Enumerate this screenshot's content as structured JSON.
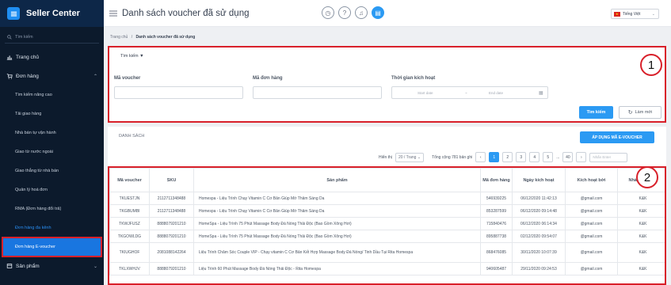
{
  "sidebar": {
    "brand": "Seller Center",
    "search_placeholder": "Tìm kiếm",
    "items": [
      {
        "label": "Trang chủ"
      },
      {
        "label": "Đơn hàng"
      }
    ],
    "sub_items": [
      {
        "label": "Tìm kiếm nâng cao"
      },
      {
        "label": "Tải giao hàng"
      },
      {
        "label": "Nhà bán tự vận hành"
      },
      {
        "label": "Giao từ nước ngoài"
      },
      {
        "label": "Giao thẳng từ nhà bán"
      },
      {
        "label": "Quản lý hoá đơn"
      },
      {
        "label": "RMA (Đơn hàng đổi trả)"
      },
      {
        "label": "Đơn hàng đa kênh"
      },
      {
        "label": "Đơn hàng E-voucher"
      }
    ],
    "bottom_item": "Sản phẩm"
  },
  "header": {
    "title": "Danh sách voucher đã sử dụng",
    "language": "Tiếng Việt"
  },
  "breadcrumb": {
    "home": "Trang chủ",
    "separator": "/",
    "current": "Danh sách voucher đã sử dụng"
  },
  "search_panel": {
    "toggle_label": "Tìm kiếm ▼",
    "voucher_label": "Mã voucher",
    "order_label": "Mã đơn hàng",
    "time_label": "Thời gian kích hoạt",
    "start_placeholder": "Start date",
    "arrow": "~",
    "end_placeholder": "End date",
    "search_button": "Tìm kiếm",
    "reset_button": "Làm mới",
    "badge": "1"
  },
  "list_panel": {
    "title": "DANH SÁCH",
    "apply_button": "ÁP DỤNG MÃ E-VOUCHER",
    "show_label": "Hiển thị",
    "per_page": "20 / Trang",
    "total": "Tổng cộng 781 bản ghi",
    "pages": [
      "1",
      "2",
      "3",
      "4",
      "5",
      "...",
      "40"
    ],
    "goto_placeholder": "Nhấn Enter",
    "badge": "2"
  },
  "table": {
    "headers": [
      "Mã voucher",
      "SKU",
      "Sản phẩm",
      "Mã đơn hàng",
      "Ngày kích hoạt",
      "Kích hoạt bởi",
      "Nhà cung cấp"
    ],
    "rows": [
      [
        "TKUESTJN",
        "2112711348488",
        "Homespa - Liệu Trình Chạy Vitamin C Cơ Bản Giúp Mờ Thâm Sáng Da",
        "546939225",
        "06/12/2020 11:42:13",
        "@gmail.com",
        "K&K"
      ],
      [
        "TKGBUMBI",
        "2112711348488",
        "Homespa - Liệu Trình Chạy Vitamin C Cơ Bản Giúp Mờ Thâm Sáng Da",
        "853287599",
        "06/12/2020 09:14:48",
        "@gmail.com",
        "K&K"
      ],
      [
        "TKWJFUSZ",
        "8888079201210",
        "HomeSpa - Liệu Trình 75 Phút Massage Body Đá Nóng Thải Độc (Bao Gồm Xông Hơi)",
        "715840476",
        "06/12/2020 06:14:34",
        "@gmail.com",
        "K&K"
      ],
      [
        "TKGOWLDG",
        "8888079201210",
        "HomeSpa - Liệu Trình 75 Phút Massage Body Đá Nóng Thải Độc (Bao Gồm Xông Hơi)",
        "895887738",
        "02/12/2020 09:54:07",
        "@gmail.com",
        "K&K"
      ],
      [
        "TKIUGHOF",
        "2081088142264",
        "Liệu Trình Chăm Sóc Couple VIP - Chạy vitamin C Cơ Bản Kết Hợp Massage Body Đá Nóng/ Tinh Dầu Tại Rita Homespa",
        "868476085",
        "30/11/2020 10:07:39",
        "@gmail.com",
        "K&K"
      ],
      [
        "TKLXWHJV",
        "8888079201210",
        "Liệu Trình 60 Phút Massage Body Đá Nóng Thải Độc - Rita Homespa",
        "940605487",
        "29/11/2020 09:24:53",
        "@gmail.com",
        "K&K"
      ]
    ]
  }
}
